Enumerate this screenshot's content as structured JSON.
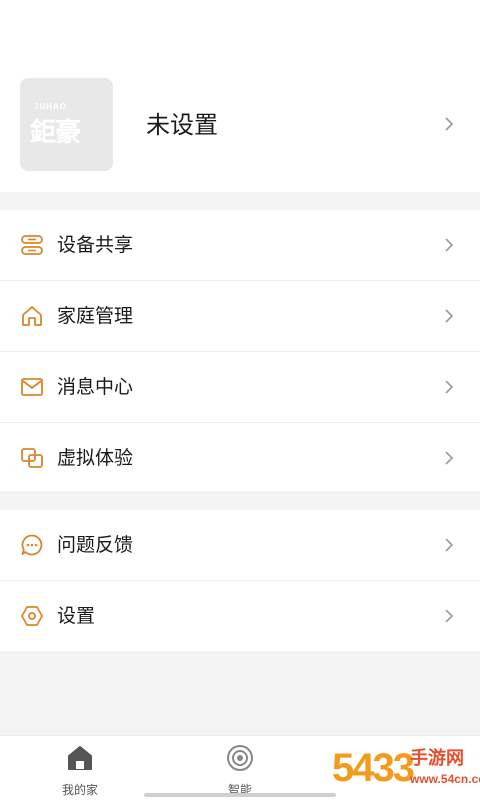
{
  "profile": {
    "avatar_brand_small": "JUHAO",
    "avatar_brand_big": "鉅豪",
    "nickname": "未设置"
  },
  "menu_group_1": [
    {
      "label": "设备共享",
      "icon": "device-share-icon"
    },
    {
      "label": "家庭管理",
      "icon": "home-outline-icon"
    },
    {
      "label": "消息中心",
      "icon": "envelope-icon"
    },
    {
      "label": "虚拟体验",
      "icon": "overlap-squares-icon"
    }
  ],
  "menu_group_2": [
    {
      "label": "问题反馈",
      "icon": "chat-bubble-icon"
    },
    {
      "label": "设置",
      "icon": "hexagon-gear-icon"
    }
  ],
  "tabbar": {
    "tabs": [
      {
        "label": "我的家",
        "icon": "house-icon"
      },
      {
        "label": "智能",
        "icon": "smart-radar-icon"
      }
    ]
  },
  "watermark": {
    "number": "5433",
    "title": "手游网",
    "url": "www.54cn.com"
  },
  "colors": {
    "accent": "#d9862a",
    "chevron": "#9a9a9a",
    "separator": "#f3f3f3"
  }
}
